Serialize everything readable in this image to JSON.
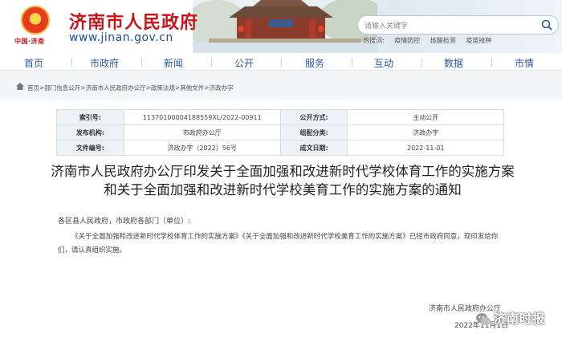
{
  "header": {
    "emblem_tag": "中国·济南",
    "site_title": "济南市人民政府",
    "site_url": "www.jinan.gov.cn",
    "search_placeholder": "请输入关键字",
    "hot_label": "热搜词:",
    "hot_terms": [
      "疫情防控",
      "核酸检测",
      "疫苗接种"
    ]
  },
  "nav": {
    "items": [
      "首页",
      "市政府",
      "新闻",
      "公开",
      "服务",
      "互动",
      "数据",
      "市情"
    ]
  },
  "breadcrumb": {
    "items": [
      "首页",
      "部门信息公开",
      "济南市人民政府办公厅",
      "政策法规",
      "其他文件",
      "济政办字"
    ],
    "separator": ">"
  },
  "info": {
    "rows": [
      {
        "k1": "索引号:",
        "v1": "11370100004188559XL/2022-00911",
        "k2": "公开方式:",
        "v2": "主动公开"
      },
      {
        "k1": "发布机构:",
        "v1": "市政府办公厅",
        "k2": "组配分类:",
        "v2": "济政办字"
      },
      {
        "k1": "文件编号:",
        "v1": "济政办字〔2022〕56号",
        "k2": "成文日期:",
        "v2": "2022-11-01"
      }
    ]
  },
  "document": {
    "title": "济南市人民政府办公厅印发关于全面加强和改进新时代学校体育工作的实施方案和关于全面加强和改进新时代学校美育工作的实施方案的通知",
    "salutation": "各区县人民政府，市政府各部门（单位）:",
    "paragraph": "《关于全面加强和改进新时代学校体育工作的实施方案》《关于全面加强和改进新时代学校美育工作的实施方案》已经市政府同意，现印发给你们，请认真组织实施。",
    "signature_org": "济南市人民政府办公厅",
    "signature_date": "2022年11月1日"
  },
  "watermark": {
    "text": "济南时报"
  },
  "colors": {
    "brand_red": "#c8161d",
    "nav_blue": "#2a5b9b"
  }
}
